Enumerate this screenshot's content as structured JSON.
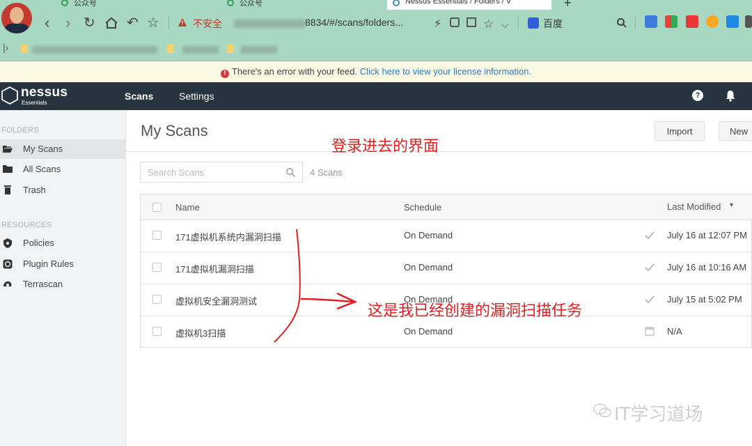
{
  "browser": {
    "tabs": [
      {
        "label": "公众号"
      },
      {
        "label": "公众号"
      },
      {
        "label": "Nessus Essentials / Folders / V"
      }
    ],
    "security_warning": "不安全",
    "url": "8834/#/scans/folders...",
    "search_engine": "百度"
  },
  "notice": {
    "text": "There's an error with your feed.",
    "link": "Click here to view your license information."
  },
  "app": {
    "logo_name": "nessus",
    "logo_sub": "Essentials",
    "nav": [
      "Scans",
      "Settings"
    ],
    "help_label": "?"
  },
  "sidebar": {
    "folders_heading": "FOLDERS",
    "folders": [
      {
        "label": "My Scans",
        "icon": "folder-open-icon",
        "selected": true
      },
      {
        "label": "All Scans",
        "icon": "folder-icon"
      },
      {
        "label": "Trash",
        "icon": "trash-icon"
      }
    ],
    "resources_heading": "RESOURCES",
    "resources": [
      {
        "label": "Policies",
        "icon": "shield-icon"
      },
      {
        "label": "Plugin Rules",
        "icon": "plugin-rules-icon"
      },
      {
        "label": "Terrascan",
        "icon": "terrascan-icon"
      }
    ]
  },
  "main": {
    "title": "My Scans",
    "import_label": "Import",
    "new_label": "New",
    "search_placeholder": "Search Scans",
    "count": "4 Scans",
    "columns": {
      "name": "Name",
      "schedule": "Schedule",
      "modified": "Last Modified",
      "sort_indicator": "▾"
    },
    "rows": [
      {
        "name": "171虚拟机系统内漏洞扫描",
        "schedule": "On Demand",
        "status_icon": "checkmark-icon",
        "modified": "July 16 at 12:07 PM"
      },
      {
        "name": "171虚拟机漏洞扫描",
        "schedule": "On Demand",
        "status_icon": "checkmark-icon",
        "modified": "July 16 at 10:16 AM"
      },
      {
        "name": "虚拟机安全漏洞测试",
        "schedule": "On Demand",
        "status_icon": "checkmark-icon",
        "modified": "July 15 at 5:02 PM"
      },
      {
        "name": "虚拟机3扫描",
        "schedule": "On Demand",
        "status_icon": "calendar-icon",
        "modified": "N/A"
      }
    ]
  },
  "annotations": {
    "login_note": "登录进去的界面",
    "tasks_note": "这是我已经创建的漏洞扫描任务",
    "accent_color": "#e02020"
  },
  "watermark": "IT学习道场"
}
